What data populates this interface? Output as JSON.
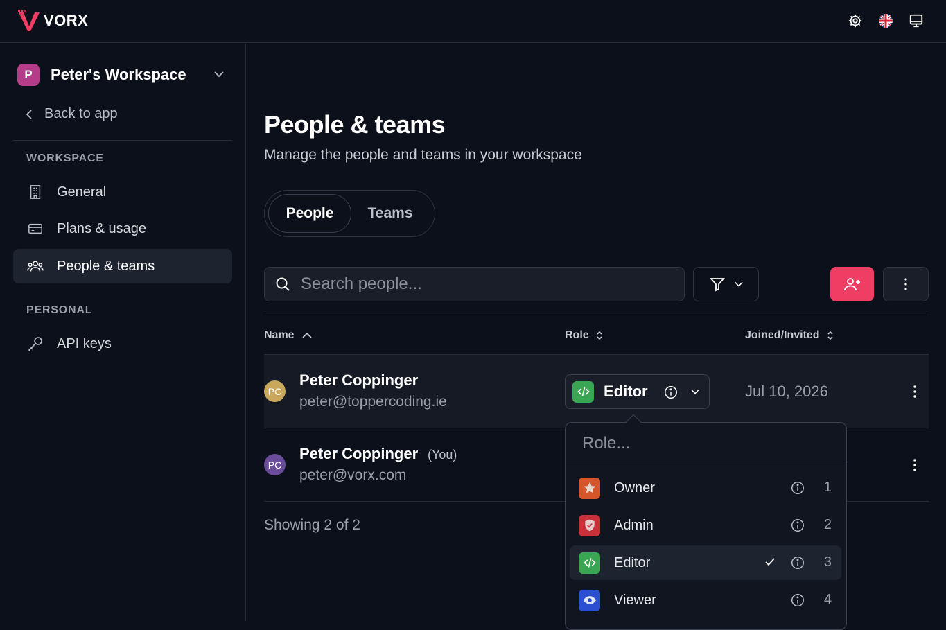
{
  "app": {
    "brand": "VORX"
  },
  "icons": {
    "settings": "gear-icon",
    "language": "uk-flag-icon",
    "display": "monitor-icon"
  },
  "colors": {
    "accent": "#ef3e64",
    "workspace_avatar": "#b53c88",
    "owner": "#d4562a",
    "admin": "#c9303a",
    "editor": "#3aa552",
    "viewer": "#2c4fd1"
  },
  "sidebar": {
    "workspace_initial": "P",
    "workspace_name": "Peter's Workspace",
    "back_label": "Back to app",
    "section_workspace": "WORKSPACE",
    "section_personal": "PERSONAL",
    "items": [
      {
        "label": "General",
        "icon": "building-icon"
      },
      {
        "label": "Plans & usage",
        "icon": "credit-card-icon"
      },
      {
        "label": "People & teams",
        "icon": "users-icon",
        "active": true
      },
      {
        "label": "API keys",
        "icon": "key-icon"
      }
    ]
  },
  "main": {
    "title": "People & teams",
    "subtitle": "Manage the people and teams in your workspace",
    "tabs": [
      {
        "label": "People",
        "active": true
      },
      {
        "label": "Teams",
        "active": false
      }
    ],
    "search_placeholder": "Search people...",
    "columns": {
      "name": "Name",
      "role": "Role",
      "joined": "Joined/Invited"
    },
    "rows": [
      {
        "initials": "PC",
        "avatar_color": "#c9a85c",
        "name": "Peter Coppinger",
        "you": "",
        "email": "peter@toppercoding.ie",
        "role": "Editor",
        "joined": "Jul 10, 2026"
      },
      {
        "initials": "PC",
        "avatar_color": "#6b4c9a",
        "name": "Peter Coppinger",
        "you": "(You)",
        "email": "peter@vorx.com",
        "role": "",
        "joined": ""
      }
    ],
    "footer": "Showing 2 of 2"
  },
  "role_dropdown": {
    "placeholder": "Role...",
    "options": [
      {
        "label": "Owner",
        "num": "1",
        "icon": "star-icon",
        "selected": false
      },
      {
        "label": "Admin",
        "num": "2",
        "icon": "shield-check-icon",
        "selected": false
      },
      {
        "label": "Editor",
        "num": "3",
        "icon": "code-icon",
        "selected": true
      },
      {
        "label": "Viewer",
        "num": "4",
        "icon": "eye-icon",
        "selected": false
      }
    ]
  }
}
